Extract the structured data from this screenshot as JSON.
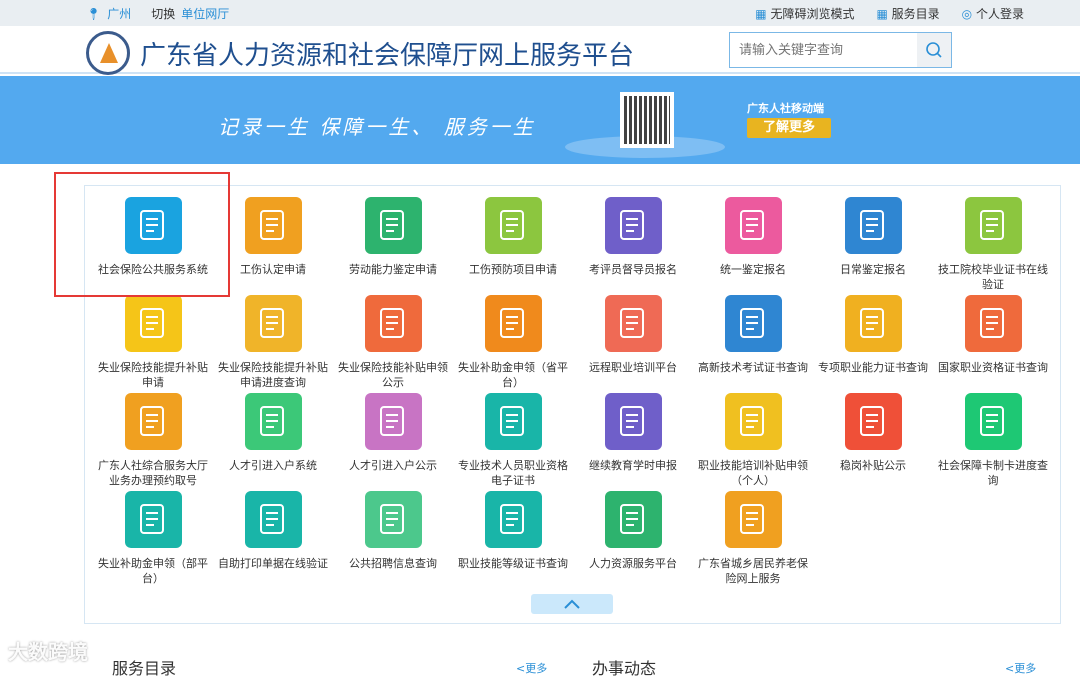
{
  "topbar": {
    "city": "广州",
    "switch": "切换",
    "unit_hall": "单位网厅",
    "accessible": "无障碍浏览模式",
    "catalog": "服务目录",
    "login": "个人登录"
  },
  "header": {
    "title": "广东省人力资源和社会保障厅网上服务平台",
    "search_placeholder": "请输入关键字查询"
  },
  "banner": {
    "slogan": "记录一生  保障一生、 服务一生",
    "mobile": "广东人社移动端",
    "learn_more": "了解更多"
  },
  "services": [
    {
      "label": "社会保险公共服务系统",
      "color": "#1aa3e0",
      "icon": "user-search-icon"
    },
    {
      "label": "工伤认定申请",
      "color": "#f0a020",
      "icon": "document-plus-icon"
    },
    {
      "label": "劳动能力鉴定申请",
      "color": "#2db36e",
      "icon": "users-transfer-icon"
    },
    {
      "label": "工伤预防项目申请",
      "color": "#8cc63f",
      "icon": "certificate-icon"
    },
    {
      "label": "考评员督导员报名",
      "color": "#6f5fc9",
      "icon": "person-card-icon"
    },
    {
      "label": "统一鉴定报名",
      "color": "#ec5a9e",
      "icon": "photo-check-icon"
    },
    {
      "label": "日常鉴定报名",
      "color": "#2f86d2",
      "icon": "id-card-edit-icon"
    },
    {
      "label": "技工院校毕业证书在线验证",
      "color": "#8cc63f",
      "icon": "certificate-icon"
    },
    {
      "label": "失业保险技能提升补贴申请",
      "color": "#f5c518",
      "icon": "checklist-icon"
    },
    {
      "label": "失业保险技能提升补贴申请进度查询",
      "color": "#f0b429",
      "icon": "medicine-bottle-icon"
    },
    {
      "label": "失业保险技能补贴申领公示",
      "color": "#ef6a3c",
      "icon": "social-card-icon"
    },
    {
      "label": "失业补助金申领（省平台）",
      "color": "#f08a1c",
      "icon": "document-yuan-icon"
    },
    {
      "label": "远程职业培训平台",
      "color": "#ef6a55",
      "icon": "id-card-icon"
    },
    {
      "label": "高新技术考试证书查询",
      "color": "#2f86d2",
      "icon": "hand-yuan-icon"
    },
    {
      "label": "专项职业能力证书查询",
      "color": "#f0b020",
      "icon": "yuan-circle-icon"
    },
    {
      "label": "国家职业资格证书查询",
      "color": "#ef6a3c",
      "icon": "person-document-icon"
    },
    {
      "label": "广东人社综合服务大厅业务办理预约取号",
      "color": "#f0a020",
      "icon": "document-plus-icon"
    },
    {
      "label": "人才引进入户系统",
      "color": "#3cc878",
      "icon": "document-person-icon"
    },
    {
      "label": "人才引进入户公示",
      "color": "#c874c4",
      "icon": "document-dollar-icon"
    },
    {
      "label": "专业技术人员职业资格电子证书",
      "color": "#19b5a8",
      "icon": "document-search-icon"
    },
    {
      "label": "继续教育学时申报",
      "color": "#6f5fc9",
      "icon": "person-card-icon"
    },
    {
      "label": "职业技能培训补贴申领（个人）",
      "color": "#f0c020",
      "icon": "medicine-bottle-icon"
    },
    {
      "label": "稳岗补贴公示",
      "color": "#ef5038",
      "icon": "documents-stack-icon"
    },
    {
      "label": "社会保障卡制卡进度查询",
      "color": "#1ec874",
      "icon": "document-search-icon"
    },
    {
      "label": "失业补助金申领（部平台）",
      "color": "#19b5a8",
      "icon": "documents-yuan-icon"
    },
    {
      "label": "自助打印单据在线验证",
      "color": "#19b5a8",
      "icon": "document-search-icon"
    },
    {
      "label": "公共招聘信息查询",
      "color": "#4cc88c",
      "icon": "nurse-icon"
    },
    {
      "label": "职业技能等级证书查询",
      "color": "#19b5a8",
      "icon": "document-search-icon"
    },
    {
      "label": "人力资源服务平台",
      "color": "#2db36e",
      "icon": "users-transfer-icon"
    },
    {
      "label": "广东省城乡居民养老保险网上服务",
      "color": "#f0a020",
      "icon": "photo-check-icon"
    }
  ],
  "bottom": {
    "catalog_title": "服务目录",
    "catalog_more": "<更多",
    "news_title": "办事动态",
    "news_more": "<更多"
  },
  "watermark": "大数跨境"
}
